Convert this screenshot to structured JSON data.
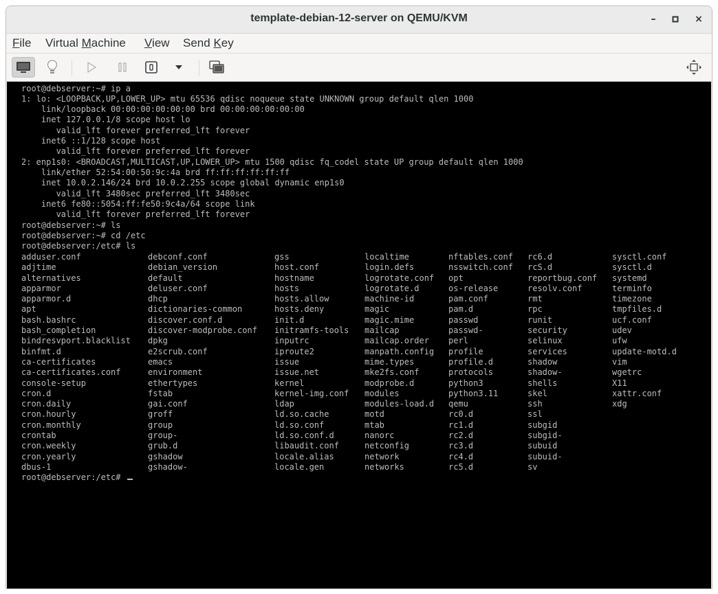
{
  "window": {
    "title": "template-debian-12-server on QEMU/KVM",
    "minimize": "–",
    "maximize": "▫",
    "close": "×"
  },
  "menu": {
    "file": "File",
    "virtual_machine": "Virtual Machine",
    "view": "View",
    "send_key": "Send Key"
  },
  "toolbar": {
    "icons": [
      "monitor-icon",
      "lightbulb-icon",
      "play-icon",
      "pause-icon",
      "power-icon",
      "dropdown-icon",
      "snapshots-icon",
      "fullscreen-icon"
    ]
  },
  "console": {
    "lines": [
      "root@debserver:~# ip a",
      "1: lo: <LOOPBACK,UP,LOWER_UP> mtu 65536 qdisc noqueue state UNKNOWN group default qlen 1000",
      "    link/loopback 00:00:00:00:00:00 brd 00:00:00:00:00:00",
      "    inet 127.0.0.1/8 scope host lo",
      "       valid_lft forever preferred_lft forever",
      "    inet6 ::1/128 scope host",
      "       valid_lft forever preferred_lft forever",
      "2: enp1s0: <BROADCAST,MULTICAST,UP,LOWER_UP> mtu 1500 qdisc fq_codel state UP group default qlen 1000",
      "    link/ether 52:54:00:50:9c:4a brd ff:ff:ff:ff:ff:ff",
      "    inet 10.0.2.146/24 brd 10.0.2.255 scope global dynamic enp1s0",
      "       valid_lft 3480sec preferred_lft 3480sec",
      "    inet6 fe80::5054:ff:fe50:9c4a/64 scope link",
      "       valid_lft forever preferred_lft forever",
      "root@debserver:~# ls",
      "root@debserver:~# cd /etc",
      "root@debserver:/etc# ls"
    ],
    "ls_columns": [
      [
        "adduser.conf",
        "adjtime",
        "alternatives",
        "apparmor",
        "apparmor.d",
        "apt",
        "bash.bashrc",
        "bash_completion",
        "bindresvport.blacklist",
        "binfmt.d",
        "ca-certificates",
        "ca-certificates.conf",
        "console-setup",
        "cron.d",
        "cron.daily",
        "cron.hourly",
        "cron.monthly",
        "crontab",
        "cron.weekly",
        "cron.yearly",
        "dbus-1"
      ],
      [
        "debconf.conf",
        "debian_version",
        "default",
        "deluser.conf",
        "dhcp",
        "dictionaries-common",
        "discover.conf.d",
        "discover-modprobe.conf",
        "dpkg",
        "e2scrub.conf",
        "emacs",
        "environment",
        "ethertypes",
        "fstab",
        "gai.conf",
        "groff",
        "group",
        "group-",
        "grub.d",
        "gshadow",
        "gshadow-"
      ],
      [
        "gss",
        "host.conf",
        "hostname",
        "hosts",
        "hosts.allow",
        "hosts.deny",
        "init.d",
        "initramfs-tools",
        "inputrc",
        "iproute2",
        "issue",
        "issue.net",
        "kernel",
        "kernel-img.conf",
        "ldap",
        "ld.so.cache",
        "ld.so.conf",
        "ld.so.conf.d",
        "libaudit.conf",
        "locale.alias",
        "locale.gen"
      ],
      [
        "localtime",
        "login.defs",
        "logrotate.conf",
        "logrotate.d",
        "machine-id",
        "magic",
        "magic.mime",
        "mailcap",
        "mailcap.order",
        "manpath.config",
        "mime.types",
        "mke2fs.conf",
        "modprobe.d",
        "modules",
        "modules-load.d",
        "motd",
        "mtab",
        "nanorc",
        "netconfig",
        "network",
        "networks"
      ],
      [
        "nftables.conf",
        "nsswitch.conf",
        "opt",
        "os-release",
        "pam.conf",
        "pam.d",
        "passwd",
        "passwd-",
        "perl",
        "profile",
        "profile.d",
        "protocols",
        "python3",
        "python3.11",
        "qemu",
        "rc0.d",
        "rc1.d",
        "rc2.d",
        "rc3.d",
        "rc4.d",
        "rc5.d"
      ],
      [
        "rc6.d",
        "rcS.d",
        "reportbug.conf",
        "resolv.conf",
        "rmt",
        "rpc",
        "runit",
        "security",
        "selinux",
        "services",
        "shadow",
        "shadow-",
        "shells",
        "skel",
        "ssh",
        "ssl",
        "subgid",
        "subgid-",
        "subuid",
        "subuid-",
        "sv"
      ],
      [
        "sysctl.conf",
        "sysctl.d",
        "systemd",
        "terminfo",
        "timezone",
        "tmpfiles.d",
        "ucf.conf",
        "udev",
        "ufw",
        "update-motd.d",
        "vim",
        "wgetrc",
        "X11",
        "xattr.conf",
        "xdg"
      ]
    ],
    "prompt_final": "root@debserver:/etc# "
  }
}
